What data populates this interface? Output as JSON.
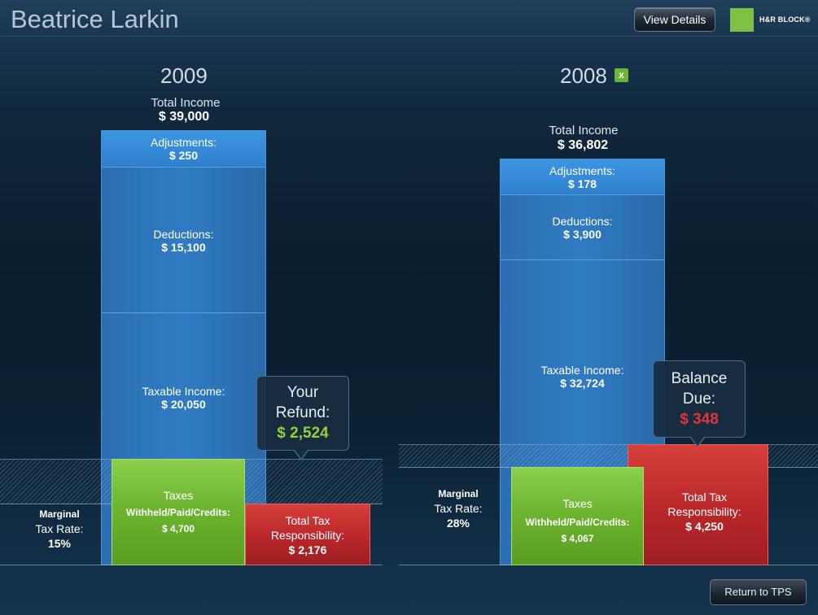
{
  "header": {
    "client_name": "Beatrice Larkin",
    "view_details_label": "View Details",
    "brand_text": "H&R BLOCK®",
    "brand_color": "#7dc244"
  },
  "year_2009": {
    "year": "2009",
    "total_income_label": "Total Income",
    "total_income_value": "$ 39,000",
    "adjustments_label": "Adjustments:",
    "adjustments_value": "$ 250",
    "deductions_label": "Deductions:",
    "deductions_value": "$ 15,100",
    "taxable_income_label": "Taxable Income:",
    "taxable_income_value": "$ 20,050",
    "taxes_label_1": "Taxes",
    "taxes_label_2": "Withheld/Paid/Credits:",
    "taxes_value": "$ 4,700",
    "total_tax_label_1": "Total Tax",
    "total_tax_label_2": "Responsibility:",
    "total_tax_value": "$ 2,176",
    "marginal_label_1": "Marginal",
    "marginal_label_2": "Tax Rate:",
    "marginal_rate": "15%",
    "callout_line_1": "Your",
    "callout_line_2": "Refund:",
    "callout_value": "$ 2,524",
    "callout_value_color": "#8fd33c"
  },
  "year_2008": {
    "year": "2008",
    "remove_icon": "x-icon",
    "total_income_label": "Total Income",
    "total_income_value": "$ 36,802",
    "adjustments_label": "Adjustments:",
    "adjustments_value": "$ 178",
    "deductions_label": "Deductions:",
    "deductions_value": "$ 3,900",
    "taxable_income_label": "Taxable Income:",
    "taxable_income_value": "$ 32,724",
    "taxes_label_1": "Taxes",
    "taxes_label_2": "Withheld/Paid/Credits:",
    "taxes_value": "$ 4,067",
    "total_tax_label_1": "Total Tax",
    "total_tax_label_2": "Responsibility:",
    "total_tax_value": "$ 4,250",
    "marginal_label_1": "Marginal",
    "marginal_label_2": "Tax Rate:",
    "marginal_rate": "28%",
    "callout_line_1": "Balance",
    "callout_line_2": "Due:",
    "callout_value": "$ 348",
    "callout_value_color": "#e0343a"
  },
  "footer": {
    "return_label": "Return to TPS"
  }
}
